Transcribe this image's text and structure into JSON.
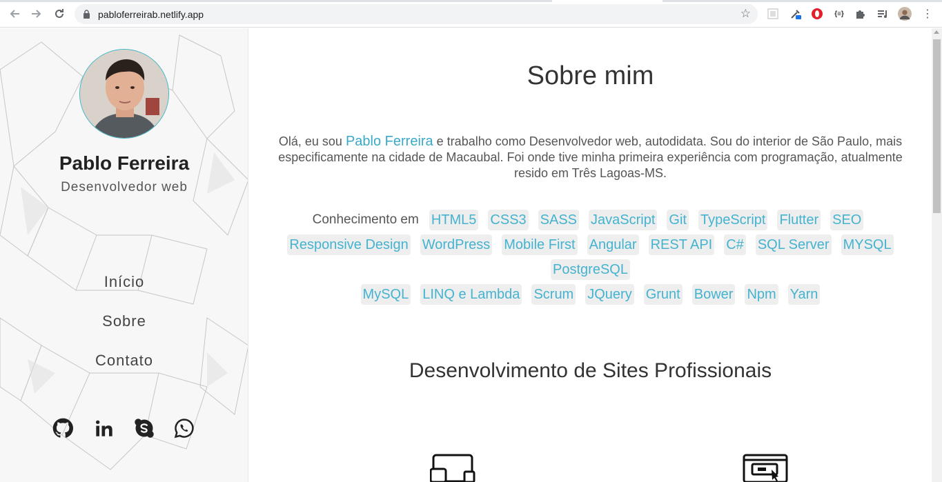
{
  "browser": {
    "url": "pabloferreirab.netlify.app",
    "back_icon": "arrow-left-icon",
    "forward_icon": "arrow-right-icon",
    "reload_icon": "reload-icon",
    "bookmark_icon": "star-icon"
  },
  "sidebar": {
    "name": "Pablo Ferreira",
    "role": "Desenvolvedor web",
    "menu": [
      {
        "label": "Início"
      },
      {
        "label": "Sobre"
      },
      {
        "label": "Contato"
      }
    ],
    "social": [
      "github-icon",
      "linkedin-icon",
      "skype-icon",
      "whatsapp-icon"
    ]
  },
  "main": {
    "title": "Sobre mim",
    "about_before": "Olá, eu sou ",
    "about_name": "Pablo Ferreira",
    "about_after": " e trabalho como Desenvolvedor web, autodidata. Sou do interior de São Paulo, mais especificamente na cidade de Macaubal. Foi onde tive minha primeira experiência com programação, atualmente resido em Três Lagoas-MS.",
    "skills_label": "Conhecimento em",
    "skills_row1": [
      "HTML5",
      "CSS3",
      "SASS",
      "JavaScript",
      "Git",
      "TypeScript",
      "Flutter",
      "SEO"
    ],
    "skills_row2": [
      "Responsive Design",
      "WordPress",
      "Mobile First",
      "Angular",
      "REST API",
      "C#",
      "SQL Server",
      "MYSQL"
    ],
    "skills_row3": [
      "PostgreSQL"
    ],
    "skills_row4": [
      "MySQL",
      "LINQ e Lambda",
      "Scrum",
      "JQuery",
      "Grunt",
      "Bower",
      "Npm",
      "Yarn"
    ],
    "section_title": "Desenvolvimento de Sites Profissionais"
  },
  "colors": {
    "accent": "#44b3cf",
    "tag_bg": "#eeeeee"
  }
}
